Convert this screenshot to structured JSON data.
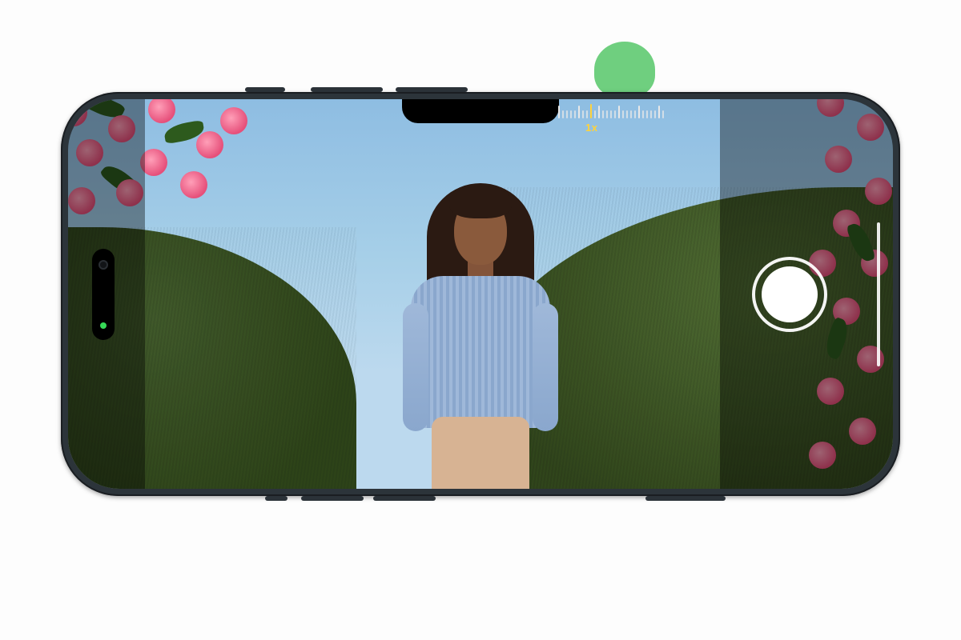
{
  "decor": {
    "dot_color": "#6fcf7f"
  },
  "device": {
    "orientation": "landscape",
    "model_tone": "#2c343a"
  },
  "camera_ui": {
    "zoom_level_label": "1x",
    "zoom_ticks": {
      "total": 27,
      "major_every": 5,
      "active_index": 8
    },
    "shutter": {
      "state": "idle",
      "color": "#ffffff"
    },
    "dim_sides": true
  },
  "status": {
    "privacy_dot": "camera-active",
    "privacy_dot_color": "#36d957"
  },
  "scene": {
    "description": "Woman standing outdoors among pink flowers and green hedge under blue sky",
    "subject": {
      "top_color": "#9fb8d9",
      "bottom_color": "#d7b393"
    }
  }
}
